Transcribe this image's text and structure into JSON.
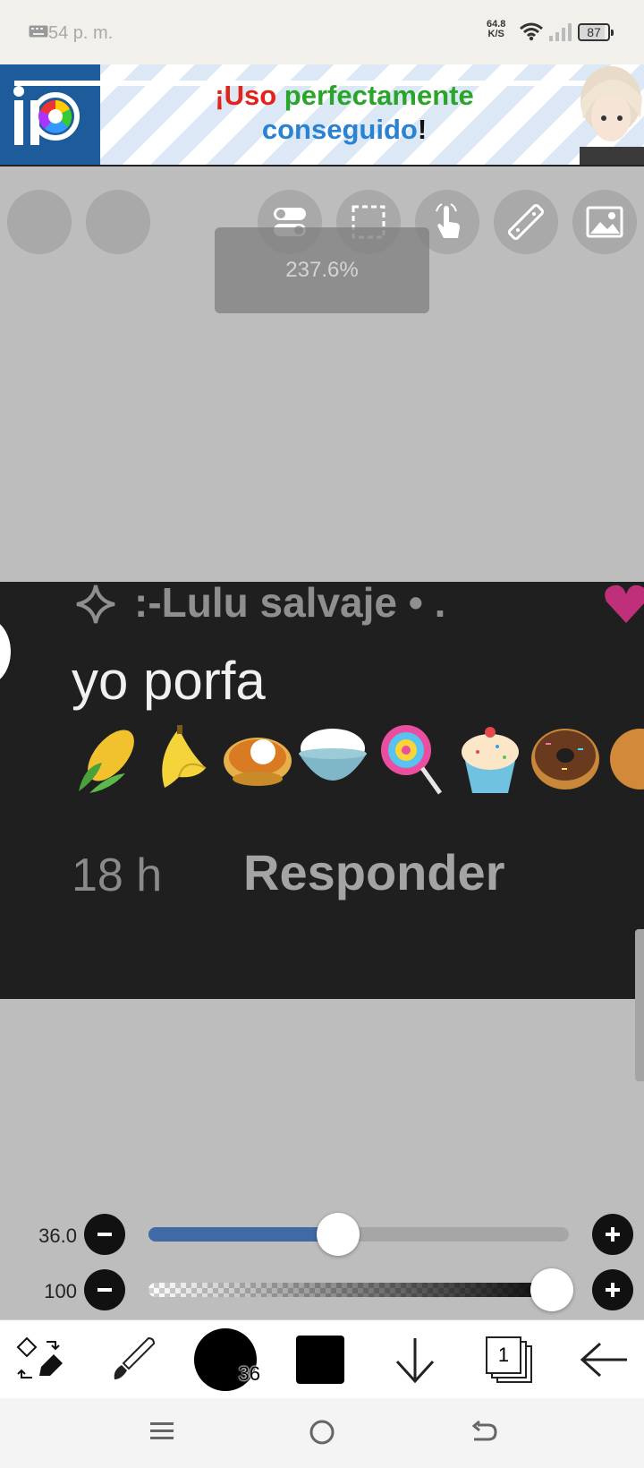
{
  "status_bar": {
    "time": "54 p. m.",
    "net_speed_value": "64.8",
    "net_speed_unit": "K/S",
    "battery": "87"
  },
  "banner": {
    "text_part1": "¡Uso",
    "text_part2": "perfectamente",
    "text_part3": "conseguido",
    "text_part4": "!"
  },
  "canvas": {
    "zoom": "237.6%",
    "artwork": {
      "username": ":-Lulu salvaje • .",
      "comment": "yo porfa",
      "emojis": "🌽🍌🍛🍚🍭🧁🍩",
      "time": "18 h",
      "reply": "Responder"
    }
  },
  "sliders": {
    "brush_size": {
      "label": "36.0",
      "fraction": 0.45
    },
    "opacity": {
      "label": "100",
      "fraction": 0.96
    }
  },
  "toolbar": {
    "brush_size_badge": "36",
    "layer_count": "1"
  },
  "colors": {
    "slider_fill": "#3f6aa5",
    "canvas_bg": "#bdbdbd",
    "artwork_bg": "#1f1f1f"
  }
}
